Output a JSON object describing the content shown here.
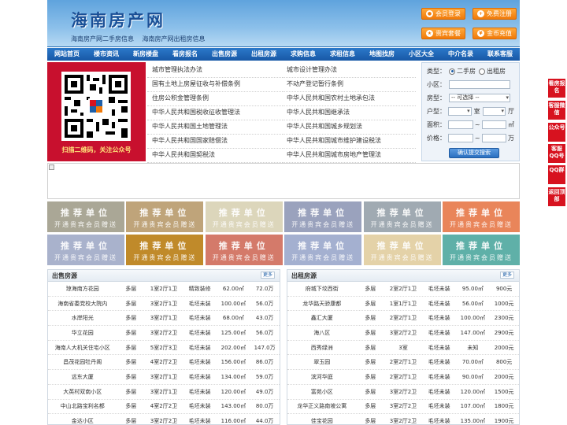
{
  "header": {
    "logo": "海南房产网",
    "subtitle": [
      "海南房产网二手房信息",
      "海南房产网出租房信息"
    ],
    "buttons": [
      {
        "label": "会员登录",
        "icon": "user-icon"
      },
      {
        "label": "免费注册",
        "icon": "register-icon"
      },
      {
        "label": "贵宾套餐",
        "icon": "vip-icon"
      },
      {
        "label": "金币充值",
        "icon": "coin-icon"
      }
    ]
  },
  "nav": [
    "网站首页",
    "楼市资讯",
    "新房楼盘",
    "看房报名",
    "出售房源",
    "出租房源",
    "求购信息",
    "求租信息",
    "地图找房",
    "小区大全",
    "中介名录",
    "联系客服"
  ],
  "qr": {
    "caption": "扫描二维码，关注公众号"
  },
  "links_left": [
    "城市管理执法办法",
    "国有土地上房屋征收与补偿条例",
    "住房公积金管理条例",
    "中华人民共和国税收征收管理法",
    "中华人民共和国土地管理法",
    "中华人民共和国国家赔偿法",
    "中华人民共和国契税法"
  ],
  "links_right": [
    "城市设计管理办法",
    "不动产登记暂行条例",
    "中华人民共和国农村土地承包法",
    "中华人民共和国继承法",
    "中华人民共和国城乡规划法",
    "中华人民共和国城市维护建设税法",
    "中华人民共和国城市房地产管理法"
  ],
  "search": {
    "type_label": "类型：",
    "type_options": [
      "二手房",
      "出租房"
    ],
    "community_label": "小区：",
    "housetype_label": "房型：",
    "housetype_value": "-- 可选择 --",
    "layout_label": "户型：",
    "room_unit": "室",
    "hall_unit": "厅",
    "area_label": "面积：",
    "area_unit": "㎡",
    "price_label": "价格：",
    "price_unit": "万",
    "range_sep": "~",
    "submit": "确认提交搜索"
  },
  "tiles": {
    "title": "推荐单位",
    "subtitle": "开通贵宾会员赠送",
    "colors": [
      "#aaa796",
      "#bfa47a",
      "#dcd6bb",
      "#9aa2bd",
      "#a0aab2",
      "#e9855a",
      "#a9b2cc",
      "#c08a2a",
      "#d47a6a",
      "#a4b0d0",
      "#e4d2a8",
      "#5fb0a8"
    ]
  },
  "sale": {
    "title": "出售房源",
    "more": "更多",
    "rows": [
      [
        "琼海南方花园",
        "多层",
        "1室2厅1卫",
        "精致装修",
        "62.00㎡",
        "72.0万"
      ],
      [
        "海南省委党校大院内",
        "多层",
        "3室2厅1卫",
        "毛坯未装",
        "100.00㎡",
        "56.0万"
      ],
      [
        "水岸阳光",
        "多层",
        "3室2厅1卫",
        "毛坯未装",
        "68.00㎡",
        "43.0万"
      ],
      [
        "华立花园",
        "多层",
        "3室2厅2卫",
        "毛坯未装",
        "125.00㎡",
        "56.0万"
      ],
      [
        "海南人大机关住宅小区",
        "多层",
        "5室2厅3卫",
        "毛坯未装",
        "202.00㎡",
        "147.0万"
      ],
      [
        "昌茂花园牡丹阁",
        "多层",
        "4室2厅2卫",
        "毛坯未装",
        "156.00㎡",
        "86.0万"
      ],
      [
        "远东大厦",
        "多层",
        "3室2厅1卫",
        "毛坯未装",
        "134.00㎡",
        "59.0万"
      ],
      [
        "大英村双南小区",
        "多层",
        "3室2厅1卫",
        "毛坯未装",
        "120.00㎡",
        "49.0万"
      ],
      [
        "中山北路宝利名都",
        "多层",
        "4室2厅2卫",
        "毛坯未装",
        "143.00㎡",
        "80.0万"
      ],
      [
        "金达小区",
        "多层",
        "3室2厅2卫",
        "毛坯未装",
        "116.00㎡",
        "44.0万"
      ]
    ]
  },
  "rent": {
    "title": "出租房源",
    "more": "更多",
    "rows": [
      [
        "府城下坟西街",
        "多层",
        "2室2厅1卫",
        "毛坯未装",
        "95.00㎡",
        "900元"
      ],
      [
        "龙华路天骄康都",
        "多层",
        "1室1厅1卫",
        "毛坯未装",
        "56.00㎡",
        "1000元"
      ],
      [
        "鑫汇大厦",
        "多层",
        "2室2厅1卫",
        "毛坯未装",
        "100.00㎡",
        "2300元"
      ],
      [
        "海八区",
        "多层",
        "3室2厅2卫",
        "毛坯未装",
        "147.00㎡",
        "2900元"
      ],
      [
        "西秀绿洲",
        "多层",
        "3室",
        "毛坯未装",
        "未知",
        "2000元"
      ],
      [
        "翠玉园",
        "多层",
        "2室2厅1卫",
        "毛坯未装",
        "70.00㎡",
        "800元"
      ],
      [
        "滨河华庭",
        "多层",
        "2室2厅1卫",
        "毛坯未装",
        "90.00㎡",
        "2000元"
      ],
      [
        "富苑小区",
        "多层",
        "3室2厅2卫",
        "毛坯未装",
        "120.00㎡",
        "1500元"
      ],
      [
        "龙华正义路南坡公寓",
        "多层",
        "3室2厅2卫",
        "毛坯未装",
        "107.00㎡",
        "1800元"
      ],
      [
        "佳宝花园",
        "多层",
        "3室2厅2卫",
        "毛坯未装",
        "135.00㎡",
        "1900元"
      ]
    ]
  },
  "side": [
    "看房报名",
    "客服微信",
    "公众号",
    "客服QQ号",
    "QQ群",
    "返回顶部"
  ]
}
